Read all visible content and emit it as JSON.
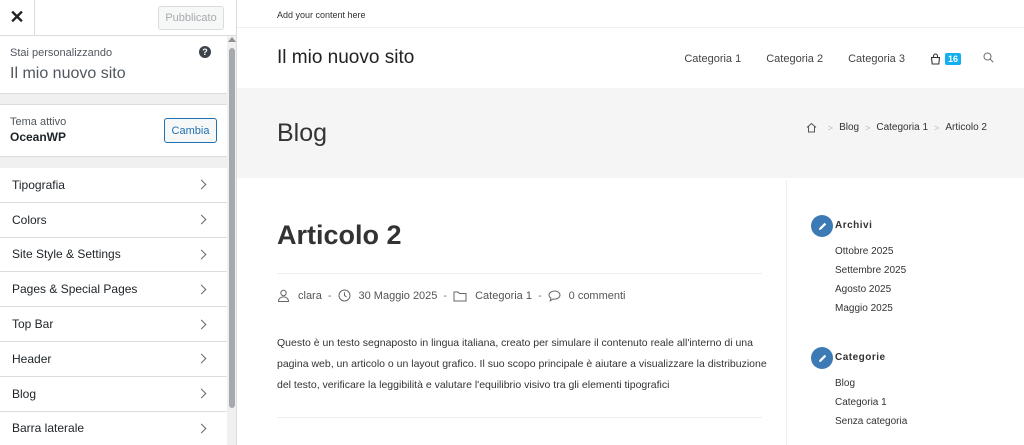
{
  "customizer": {
    "close_glyph": "✕",
    "publish_label": "Pubblicato",
    "customizing_label": "Stai personalizzando",
    "site_name": "Il mio nuovo sito",
    "help_glyph": "?",
    "active_theme_label": "Tema attivo",
    "theme_name": "OceanWP",
    "change_label": "Cambia",
    "sections": [
      {
        "label": "Tipografia"
      },
      {
        "label": "Colors"
      },
      {
        "label": "Site Style & Settings"
      },
      {
        "label": "Pages & Special Pages"
      },
      {
        "label": "Top Bar"
      },
      {
        "label": "Header"
      },
      {
        "label": "Blog"
      },
      {
        "label": "Barra laterale"
      }
    ]
  },
  "preview": {
    "topbar_text": "Add your content here",
    "site_title": "Il mio nuovo sito",
    "nav": [
      "Categoria 1",
      "Categoria 2",
      "Categoria 3"
    ],
    "cart_count": "16",
    "page_title": "Blog",
    "breadcrumb": [
      "Blog",
      "Categoria 1",
      "Articolo 2"
    ],
    "breadcrumb_sep": ">",
    "post": {
      "title": "Articolo 2",
      "author": "clara",
      "date": "30 Maggio 2025",
      "category": "Categoria 1",
      "comments": "0 commenti",
      "meta_sep": "-",
      "excerpt": "Questo è un testo segnaposto in lingua italiana, creato per simulare il contenuto reale all'interno di una pagina web, un articolo o un layout grafico. Il suo scopo principale è aiutare a visualizzare la distribuzione del testo, verificare la leggibilità e valutare l'equilibrio visivo tra gli elementi tipografici"
    },
    "widgets": [
      {
        "title": "Archivi",
        "items": [
          "Ottobre 2025",
          "Settembre 2025",
          "Agosto 2025",
          "Maggio 2025"
        ]
      },
      {
        "title": "Categorie",
        "items": [
          "Blog",
          "Categoria 1",
          "Senza categoria"
        ]
      }
    ],
    "colors": {
      "accent": "#13aff0",
      "edit_icon": "#3c7ab5"
    }
  }
}
